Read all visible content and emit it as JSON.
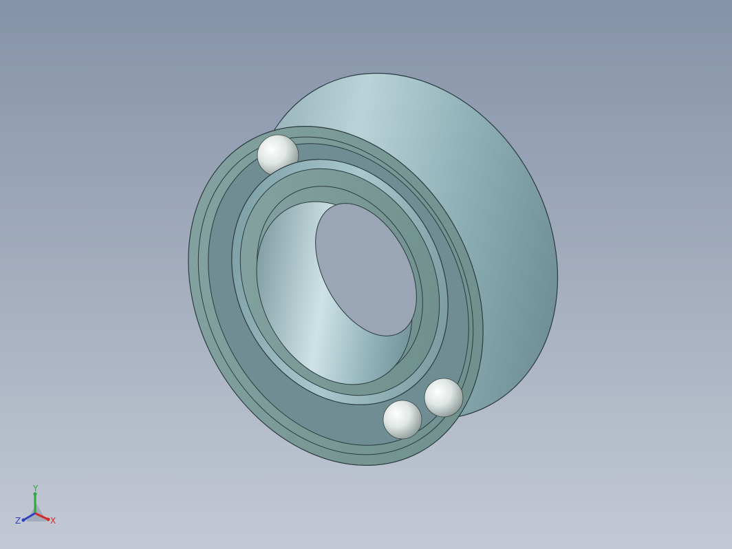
{
  "viewport": {
    "background_top": "#8593a8",
    "background_bottom": "#c3c9d4"
  },
  "model": {
    "part": "deep-groove-ball-bearing",
    "steel_color": "#9fb9bf",
    "face_color": "#7f9f9c",
    "ball_color": "#dde3e1",
    "visible_balls": 3
  },
  "triad": {
    "x_label": "X",
    "y_label": "Y",
    "z_label": "Z",
    "x_color": "#d42a2a",
    "y_color": "#2fa83a",
    "z_color": "#2e3fbf"
  }
}
